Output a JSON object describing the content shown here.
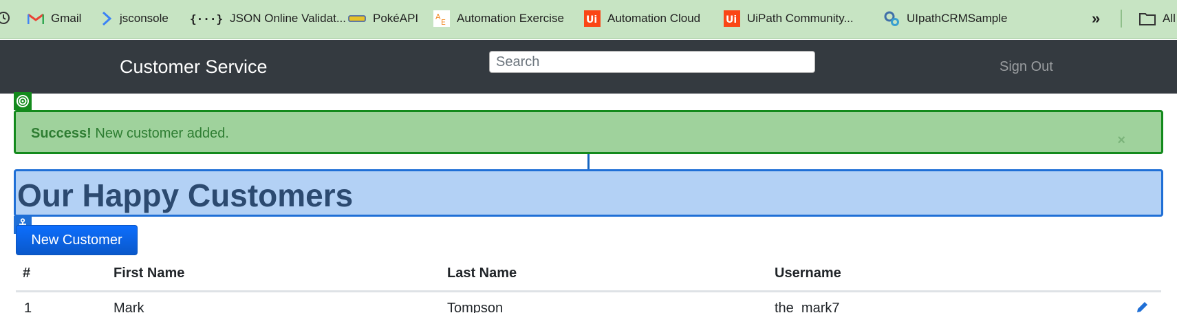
{
  "bookmarks": {
    "items": [
      {
        "label": "Gmail",
        "icon": "gmail-icon"
      },
      {
        "label": "jsconsole",
        "icon": "chevron-right-icon"
      },
      {
        "label": "JSON Online Validat...",
        "icon": "json-braces-icon"
      },
      {
        "label": "PokéAPI",
        "icon": "pokeapi-icon"
      },
      {
        "label": "Automation Exercise",
        "icon": "automation-exercise-icon"
      },
      {
        "label": "Automation Cloud",
        "icon": "uipath-icon"
      },
      {
        "label": "UiPath Community...",
        "icon": "uipath-icon"
      },
      {
        "label": "UIpathCRMSample",
        "icon": "gears-icon"
      }
    ],
    "overflow_label": "»",
    "all_label": "All"
  },
  "navbar": {
    "brand": "Customer Service",
    "search_placeholder": "Search",
    "sign_out": "Sign Out"
  },
  "alert": {
    "strong": "Success!",
    "message": "New customer added.",
    "close": "×"
  },
  "page": {
    "title": "Our Happy Customers",
    "new_button": "New Customer"
  },
  "table": {
    "headers": [
      "#",
      "First Name",
      "Last Name",
      "Username"
    ],
    "rows": [
      [
        "1",
        "Mark",
        "Tompson",
        "the_mark7"
      ]
    ]
  },
  "colors": {
    "bookmarks_bg": "#c7e4c3",
    "navbar_bg": "#343a40",
    "alert_bg": "#9fd29c",
    "alert_border": "#138a1c",
    "heading_bg": "#b3d1f5",
    "heading_border": "#1f6fd6",
    "primary": "#0d6efd"
  }
}
